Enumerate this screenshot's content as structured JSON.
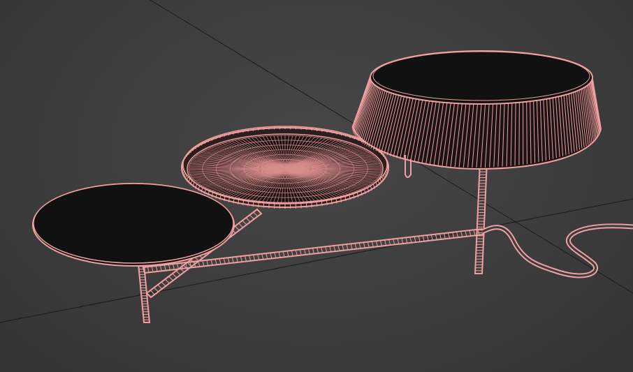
{
  "viewport": {
    "background": "#3d3d3d",
    "wire_color": "#f0a0a0",
    "fill_color": "#111111",
    "grid_color": "#1a1a1a"
  },
  "objects": [
    {
      "name": "left-tabletop",
      "shape": "disc"
    },
    {
      "name": "middle-tray",
      "shape": "tray-with-rim"
    },
    {
      "name": "lamp-shade",
      "shape": "drum-shade"
    },
    {
      "name": "metal-frame",
      "shape": "tube-frame"
    },
    {
      "name": "power-cable",
      "shape": "cable"
    }
  ]
}
